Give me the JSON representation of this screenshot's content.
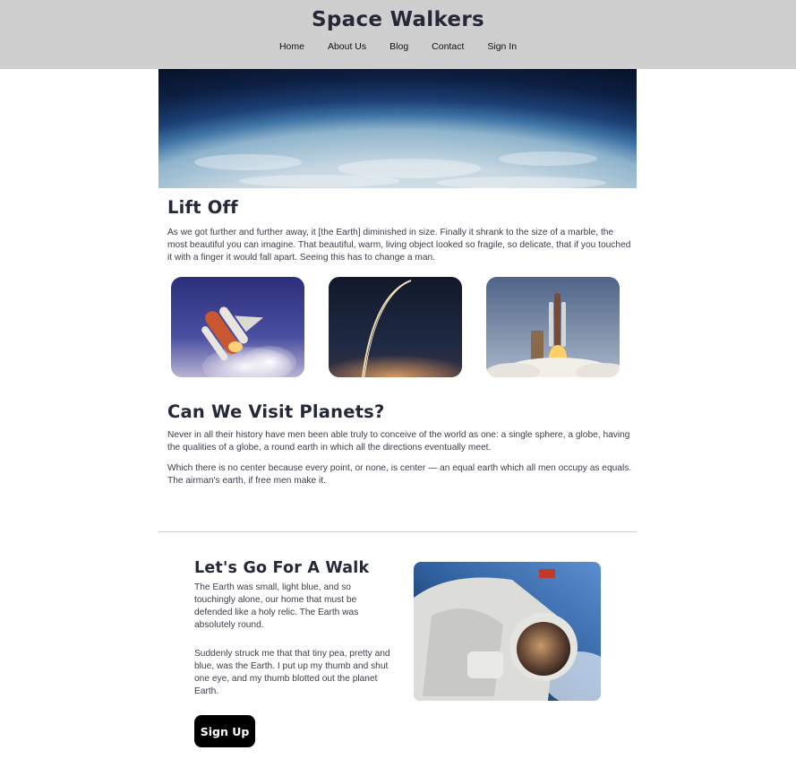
{
  "site": {
    "title": "Space Walkers"
  },
  "nav": {
    "items": [
      "Home",
      "About Us",
      "Blog",
      "Contact",
      "Sign In"
    ]
  },
  "liftoff": {
    "heading": "Lift Off",
    "paragraph": "As we got further and further away, it [the Earth] diminished in size. Finally it shrank to the size of a marble, the most beautiful you can imagine. That beautiful, warm, living object looked so fragile, so delicate, that if you touched it with a finger it would fall apart. Seeing this has to change a man."
  },
  "planets": {
    "heading": "Can We Visit Planets?",
    "paragraphs": [
      "Never in all their history have men been able truly to conceive of the world as one: a single sphere, a globe, having the qualities of a globe, a round earth in which all the directions eventually meet.",
      "Which there is no center because every point, or none, is center — an equal earth which all men occupy as equals. The airman's earth, if free men make it."
    ]
  },
  "walk": {
    "heading": "Let's Go For A Walk",
    "paragraphs": [
      "The Earth was small, light blue, and so touchingly alone, our home that must be defended like a holy relic. The Earth was absolutely round.",
      "Suddenly struck me that that tiny pea, pretty and blue, was the Earth. I put up my thumb and shut one eye, and my thumb blotted out the planet Earth."
    ],
    "button": "Sign Up"
  },
  "colors": {
    "header_bg": "#cfcfcf",
    "heading": "#252839",
    "button_bg": "#000000",
    "button_text": "#ffffff"
  }
}
